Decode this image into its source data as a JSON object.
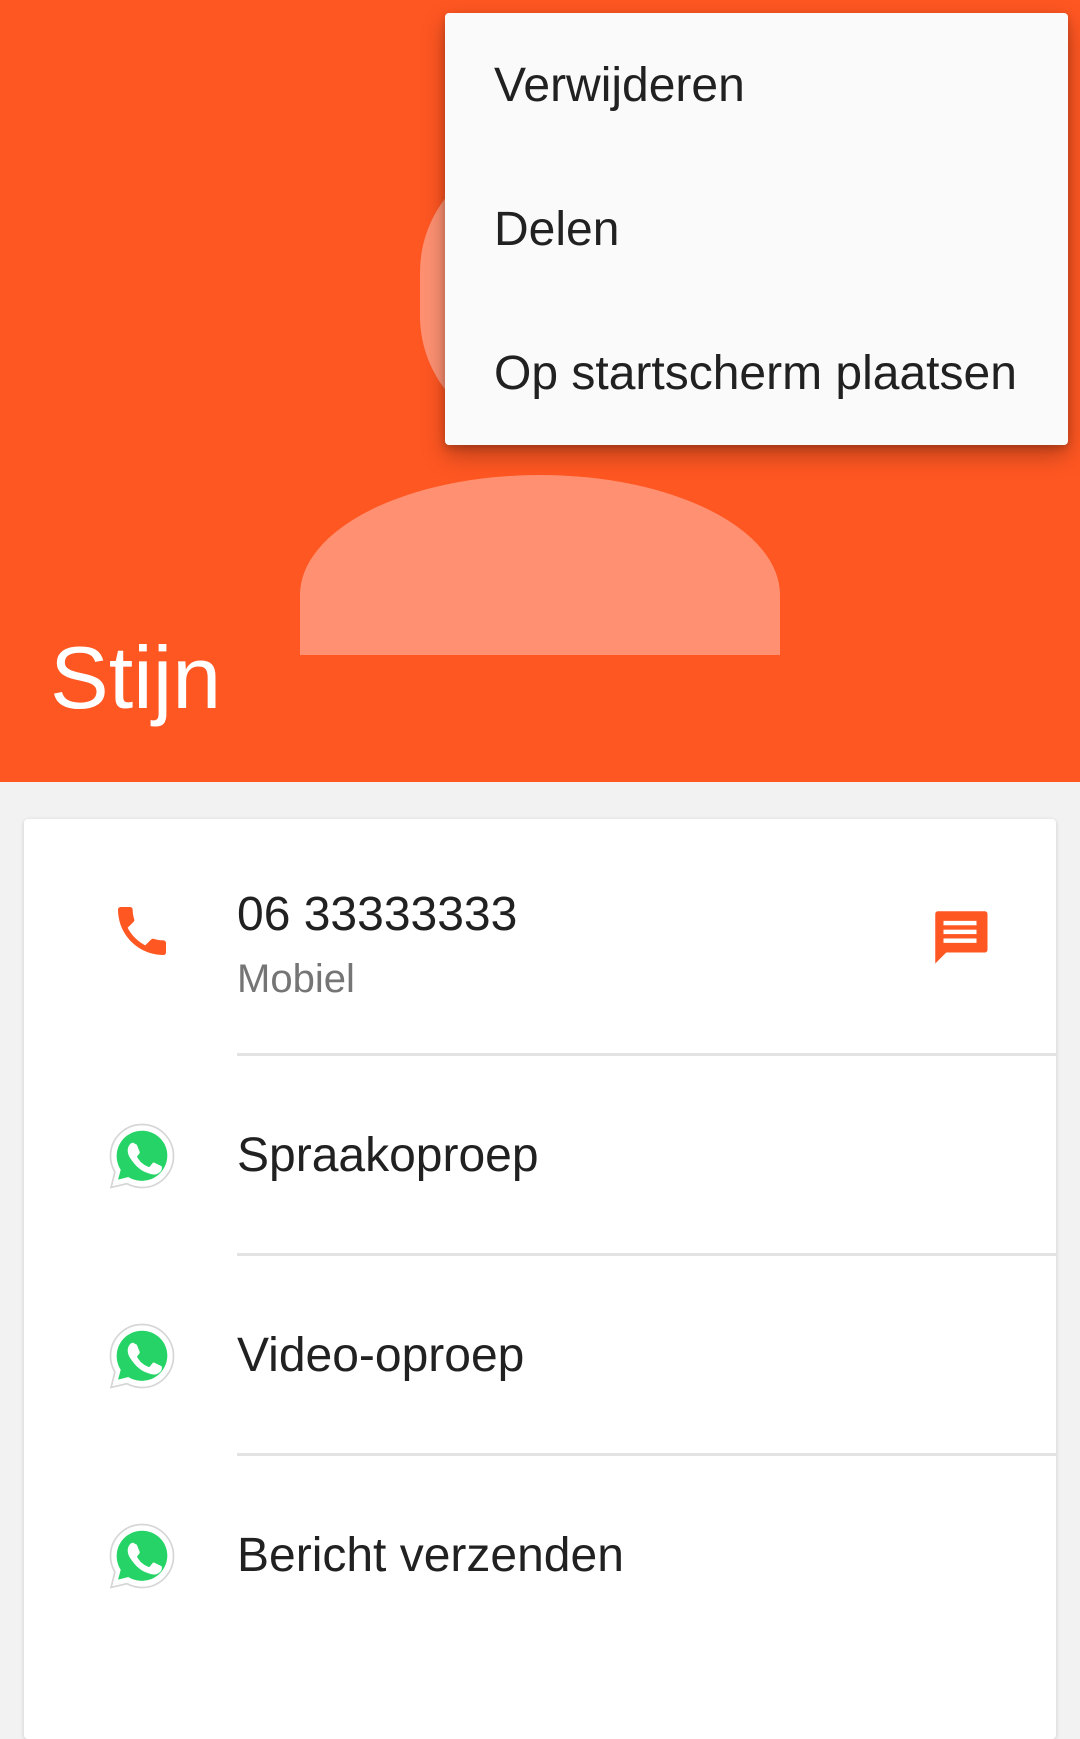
{
  "header": {
    "background_color": "#ff5722",
    "contact_name": "Stijn"
  },
  "overflow_menu": {
    "items": [
      {
        "label": "Verwijderen"
      },
      {
        "label": "Delen"
      },
      {
        "label": "Op startscherm plaatsen"
      }
    ]
  },
  "contact_card": {
    "phone": {
      "number": "06 33333333",
      "type": "Mobiel",
      "icon": "phone-icon",
      "message_icon": "sms-icon"
    },
    "whatsapp_actions": [
      {
        "label": "Spraakoproep",
        "icon": "whatsapp-icon"
      },
      {
        "label": "Video-oproep",
        "icon": "whatsapp-icon"
      },
      {
        "label": "Bericht verzenden",
        "icon": "whatsapp-icon"
      }
    ]
  },
  "colors": {
    "accent": "#ff5722",
    "whatsapp_green": "#25d366"
  }
}
